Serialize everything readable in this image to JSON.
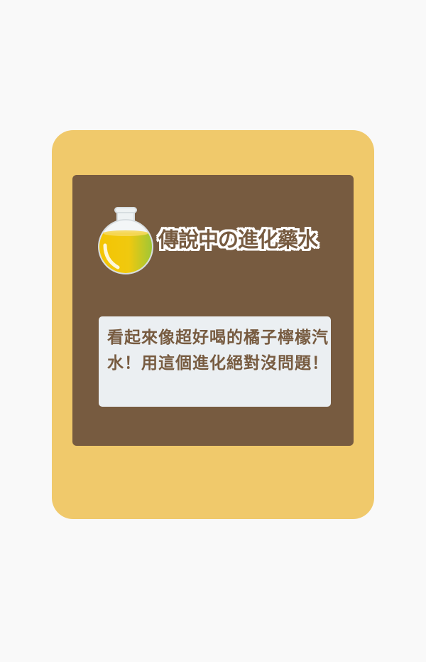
{
  "item": {
    "icon": "potion-flask-icon",
    "name": "傳說中の進化藥水",
    "description": "看起來像超好喝的橘子檸檬汽水！用這個進化絕對沒問題！"
  },
  "colors": {
    "page_background": "#f9f9f9",
    "card_frame": "#f0c96b",
    "card_panel": "#775b40",
    "description_box": "#ebeff2",
    "text": "#775b40",
    "potion_top": "#f2c20f",
    "potion_bottom": "#8cc63f"
  }
}
